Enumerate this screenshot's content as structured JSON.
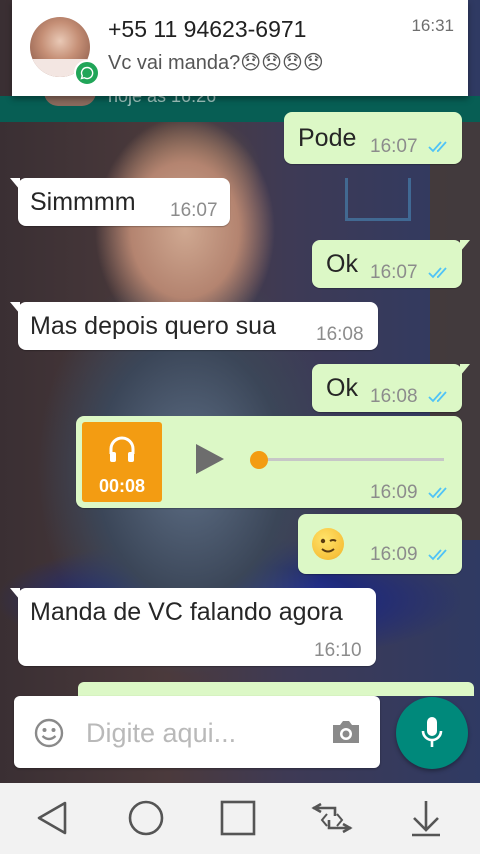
{
  "notification": {
    "title": "+55 11 94623-6971",
    "text": "Vc vai manda?😞😞😞😞",
    "time": "16:31",
    "app_icon": "whatsapp-icon"
  },
  "chat_header": {
    "last_seen": "hoje às 16:26"
  },
  "messages": [
    {
      "direction": "out",
      "text": "Pode",
      "time": "16:07",
      "status": "read"
    },
    {
      "direction": "in",
      "text": "Simmmm",
      "time": "16:07"
    },
    {
      "direction": "out",
      "text": "Ok",
      "time": "16:07",
      "status": "read"
    },
    {
      "direction": "in",
      "text": "Mas depois quero sua",
      "time": "16:08"
    },
    {
      "direction": "out",
      "text": "Ok",
      "time": "16:08",
      "status": "read"
    },
    {
      "direction": "out",
      "type": "audio",
      "duration": "00:08",
      "time": "16:09",
      "status": "read",
      "progress": 0
    },
    {
      "direction": "out",
      "type": "emoji",
      "emoji": "winking-face",
      "time": "16:09",
      "status": "read"
    },
    {
      "direction": "in",
      "text": "Manda de VC falando agora",
      "time": "16:10"
    }
  ],
  "composer": {
    "placeholder": "Digite aqui...",
    "emoji_icon": "smiley-icon",
    "camera_icon": "camera-icon",
    "mic_icon": "microphone-icon"
  },
  "colors": {
    "outgoing_bubble": "#dcf8c6",
    "incoming_bubble": "#ffffff",
    "read_ticks": "#4fc3f7",
    "audio_accent": "#f39c12",
    "mic_button": "#00897b",
    "header": "#075e54"
  },
  "navbar": [
    "back-icon",
    "home-icon",
    "recents-icon",
    "switch-apps-icon",
    "notification-pull-icon"
  ]
}
